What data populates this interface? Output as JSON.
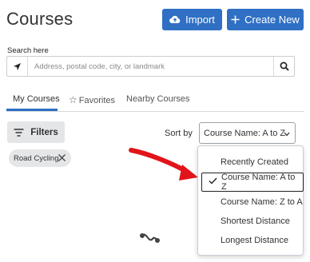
{
  "header": {
    "title": "Courses",
    "import_label": "Import",
    "create_label": "Create New"
  },
  "search": {
    "label": "Search here",
    "placeholder": "Address, postal code, city, or landmark"
  },
  "tabs": [
    {
      "label": "My Courses",
      "active": true
    },
    {
      "label": "Favorites",
      "active": false
    },
    {
      "label": "Nearby Courses",
      "active": false
    }
  ],
  "filters": {
    "button_label": "Filters",
    "chips": [
      {
        "label": "Road Cycling"
      }
    ]
  },
  "sort": {
    "label": "Sort by",
    "selected": "Course Name: A to Z",
    "options": [
      "Recently Created",
      "Course Name: A to Z",
      "Course Name: Z to A",
      "Shortest Distance",
      "Longest Distance"
    ]
  },
  "colors": {
    "primary": "#2f6fc4",
    "annotation_arrow": "#e1141b"
  }
}
